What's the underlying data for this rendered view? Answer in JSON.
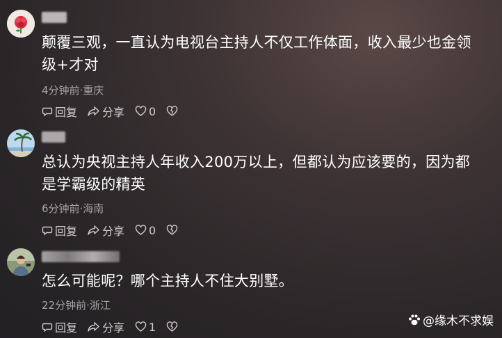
{
  "comments": [
    {
      "username": "沈某",
      "text_line1": "颠覆三观，一直认为电视台主持人不仅工作体面，收入最少也金领",
      "text_line2": "级+才对",
      "meta": "4分钟前·重庆",
      "reply_label": "回复",
      "share_label": "分享",
      "like_count": "0"
    },
    {
      "username": "用户",
      "text_line1": "总认为央视主持人年收入200万以上，但都认为应该要的，因为都",
      "text_line2": "是学霸级的精英",
      "meta": "6分钟前·海南",
      "reply_label": "回复",
      "share_label": "分享",
      "like_count": "0"
    },
    {
      "username": "用户昵称",
      "text_line1": "怎么可能呢？哪个主持人不住大别墅。",
      "meta": "22分钟前·浙江",
      "reply_label": "回复",
      "share_label": "分享",
      "like_count": "1"
    }
  ],
  "watermark": "@缘木不求娱",
  "icons": [
    "rose-avatar",
    "palm-tree-avatar",
    "person-avatar",
    "reply-icon",
    "share-icon",
    "heart-icon",
    "broken-heart-icon",
    "paw-icon"
  ]
}
